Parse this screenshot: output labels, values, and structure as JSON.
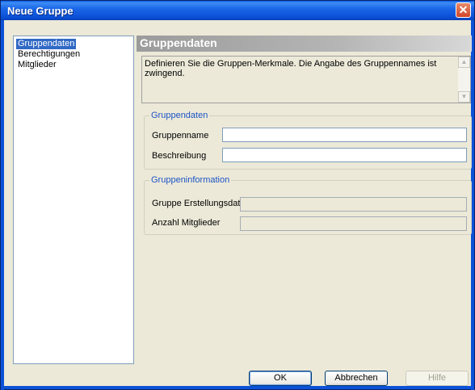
{
  "window": {
    "title": "Neue Gruppe",
    "close_icon": "close-icon"
  },
  "nav": {
    "items": [
      "Gruppendaten",
      "Berechtigungen",
      "Mitglieder"
    ],
    "selected": "Gruppendaten"
  },
  "header": {
    "title": "Gruppendaten"
  },
  "description": {
    "text": "Definieren Sie die Gruppen-Merkmale. Die Angabe des Gruppennames ist zwingend."
  },
  "group_data": {
    "legend": "Gruppendaten",
    "name_label": "Gruppenname",
    "name_value": "",
    "description_label": "Beschreibung",
    "description_value": ""
  },
  "group_info": {
    "legend": "Gruppeninformation",
    "created_label": "Gruppe Erstellungsdatum",
    "created_value": "",
    "members_label": "Anzahl Mitglieder",
    "members_value": ""
  },
  "buttons": {
    "ok": "OK",
    "cancel": "Abbrechen",
    "help": "Hilfe"
  },
  "colors": {
    "selection": "#316ac5",
    "accent": "#1c53c6",
    "titlebar": "#0a4fd6"
  }
}
